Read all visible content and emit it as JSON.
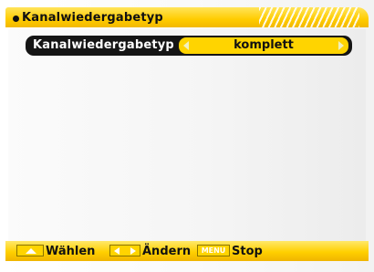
{
  "header": {
    "title": "Kanalwiedergabetyp"
  },
  "settings": {
    "label": "Kanalwiedergabetyp",
    "value": "komplett"
  },
  "footer": {
    "select_label": "Wählen",
    "change_label": "Ändern",
    "menu_key_label": "MENU",
    "stop_label": "Stop"
  },
  "colors": {
    "accent_yellow": "#ffd400",
    "row_background": "#151515",
    "text_dark": "#111111"
  },
  "icons": {
    "title_bullet": "bullet-dot-icon",
    "value_left": "arrow-left-icon",
    "value_right": "arrow-right-icon",
    "select_key": "up-down-key-icon",
    "change_key": "left-right-key-icon",
    "menu_key": "menu-key-icon"
  }
}
